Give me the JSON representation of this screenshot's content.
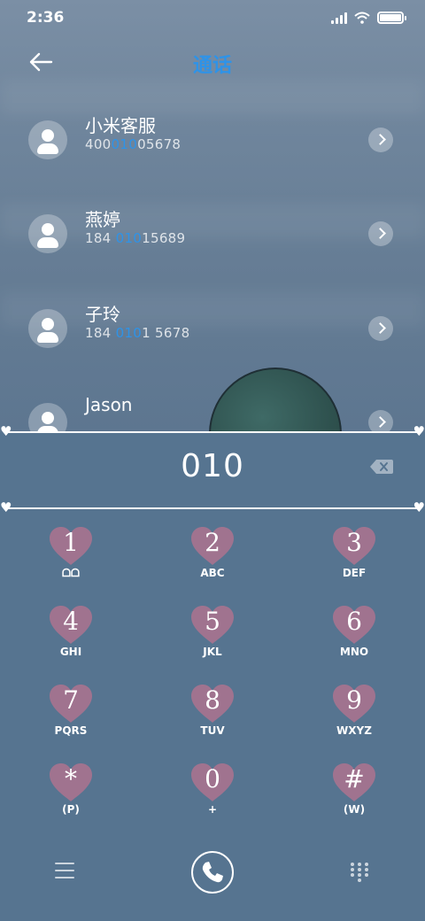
{
  "status_bar": {
    "time": "2:36",
    "battery_level": 1.0
  },
  "header": {
    "title": "通话"
  },
  "contacts": [
    {
      "name": "小米客服",
      "number_pre": "400",
      "number_match": "010",
      "number_post": "05678"
    },
    {
      "name": "燕婷",
      "number_pre": "184 ",
      "number_match": "010",
      "number_post": "15689"
    },
    {
      "name": "子玲",
      "number_pre": "184 ",
      "number_match": "010",
      "number_post": "1 5678"
    },
    {
      "name": "Jason",
      "number_pre": "",
      "number_match": "",
      "number_post": ""
    }
  ],
  "dialer": {
    "input_value": "010",
    "keys": [
      {
        "digit": "1",
        "letters": "ᗝᗝ"
      },
      {
        "digit": "2",
        "letters": "ABC"
      },
      {
        "digit": "3",
        "letters": "DEF"
      },
      {
        "digit": "4",
        "letters": "GHI"
      },
      {
        "digit": "5",
        "letters": "JKL"
      },
      {
        "digit": "6",
        "letters": "MNO"
      },
      {
        "digit": "7",
        "letters": "PQRS"
      },
      {
        "digit": "8",
        "letters": "TUV"
      },
      {
        "digit": "9",
        "letters": "WXYZ"
      },
      {
        "digit": "*",
        "letters": "(P)"
      },
      {
        "digit": "0",
        "letters": "+"
      },
      {
        "digit": "#",
        "letters": "(W)"
      }
    ]
  },
  "icons": {
    "back": "arrow-left-icon",
    "contact_avatar": "person-icon",
    "chevron": "chevron-right-icon",
    "backspace": "backspace-icon",
    "menu": "hamburger-icon",
    "call": "phone-icon",
    "keypad": "dialpad-icon",
    "divider_end": "heart-icon"
  },
  "colors": {
    "accent": "#2e93e8",
    "key_heart": "#a0738f",
    "panel": "#567490"
  }
}
